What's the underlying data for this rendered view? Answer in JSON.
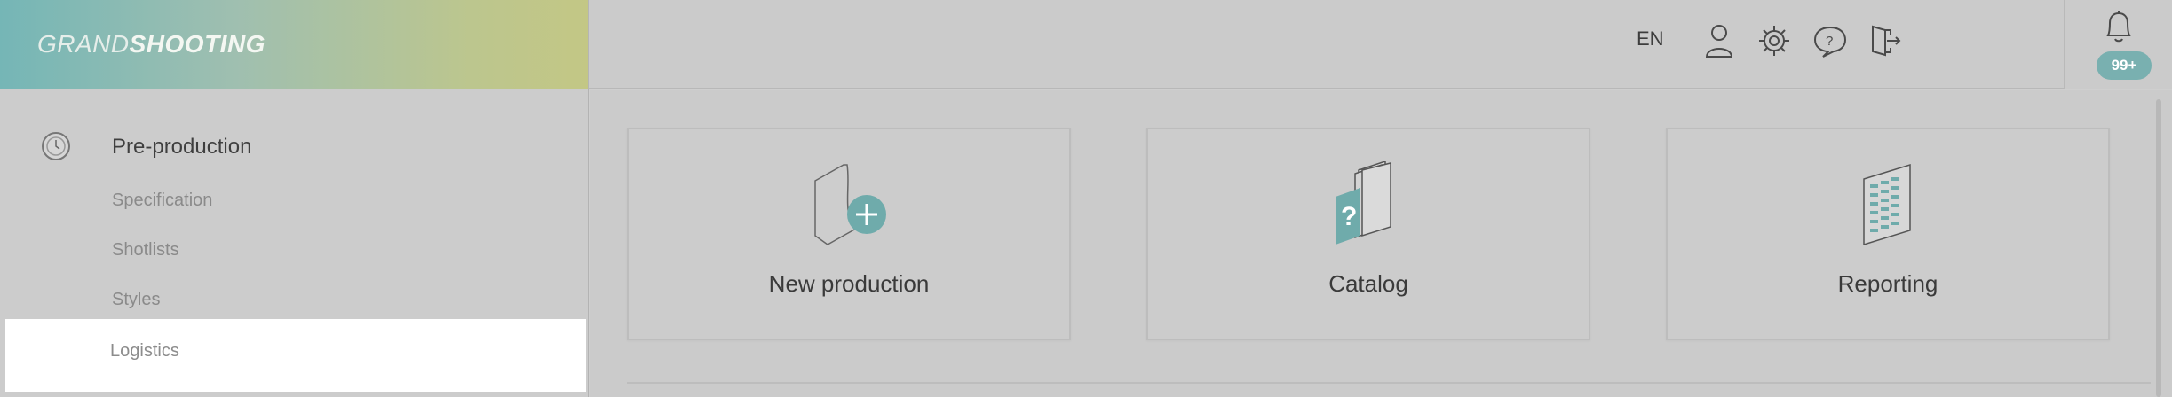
{
  "logo": {
    "part1": "GRAND",
    "part2": "SHOOTING"
  },
  "header": {
    "language": "EN",
    "icons": [
      "user-icon",
      "settings-icon",
      "help-icon",
      "logout-icon"
    ],
    "notifications": {
      "icon": "bell-icon",
      "badge": "99+"
    }
  },
  "sidebar": {
    "section": {
      "icon": "clock-icon",
      "label": "Pre-production"
    },
    "items": [
      {
        "label": "Specification",
        "active": false
      },
      {
        "label": "Shotlists",
        "active": false
      },
      {
        "label": "Styles",
        "active": false
      },
      {
        "label": "Logistics",
        "active": true
      }
    ]
  },
  "cards": [
    {
      "label": "New production",
      "icon": "new-production-icon"
    },
    {
      "label": "Catalog",
      "icon": "catalog-icon"
    },
    {
      "label": "Reporting",
      "icon": "reporting-icon"
    }
  ],
  "colors": {
    "accent": "#75b0b0",
    "background": "#cbcbcb",
    "active_item": "#ffffff"
  }
}
